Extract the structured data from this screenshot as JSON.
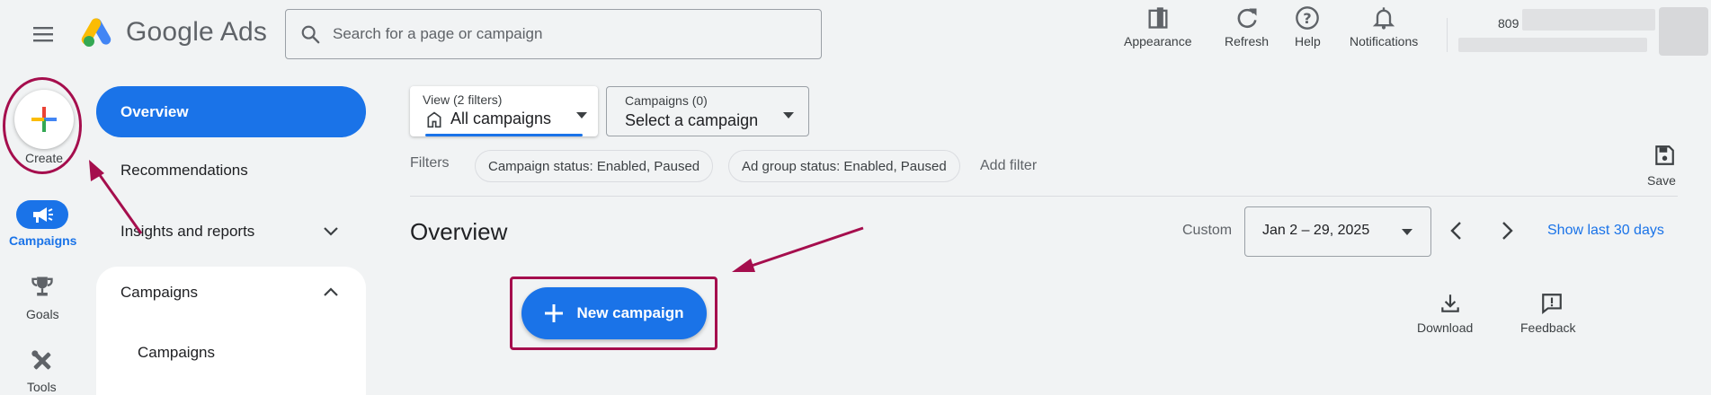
{
  "app": {
    "logo_text": "Google Ads"
  },
  "search": {
    "placeholder": "Search for a page or campaign"
  },
  "toolbar": {
    "appearance": "Appearance",
    "refresh": "Refresh",
    "help": "Help",
    "notifications": "Notifications"
  },
  "account": {
    "id_prefix": "809"
  },
  "rail": {
    "create": "Create",
    "campaigns": "Campaigns",
    "goals": "Goals",
    "tools": "Tools"
  },
  "nav": {
    "overview": "Overview",
    "recommendations": "Recommendations",
    "insights": "Insights and reports",
    "campaigns_group": "Campaigns",
    "campaigns_sub": "Campaigns"
  },
  "view_selector": {
    "label": "View (2 filters)",
    "value": "All campaigns"
  },
  "campaign_selector": {
    "label": "Campaigns (0)",
    "value": "Select a campaign"
  },
  "filters": {
    "label": "Filters",
    "chips": [
      "Campaign status: Enabled, Paused",
      "Ad group status: Enabled, Paused"
    ],
    "add": "Add filter"
  },
  "save": "Save",
  "page": {
    "title": "Overview"
  },
  "date": {
    "custom_label": "Custom",
    "range": "Jan 2 – 29, 2025",
    "show_last": "Show last 30 days"
  },
  "new_campaign": "New campaign",
  "actions": {
    "download": "Download",
    "feedback": "Feedback"
  },
  "colors": {
    "accent": "#1a73e8",
    "annotation": "#a50e4d",
    "background": "#f1f3f4"
  },
  "icons": {
    "menu": "menu-icon",
    "search": "search-icon",
    "appearance": "appearance-icon",
    "refresh": "refresh-icon",
    "help": "help-icon",
    "notifications": "bell-icon",
    "create": "plus-icon",
    "campaigns": "megaphone-icon",
    "goals": "trophy-icon",
    "tools": "tools-icon",
    "save": "save-icon",
    "download": "download-icon",
    "feedback": "feedback-icon"
  }
}
